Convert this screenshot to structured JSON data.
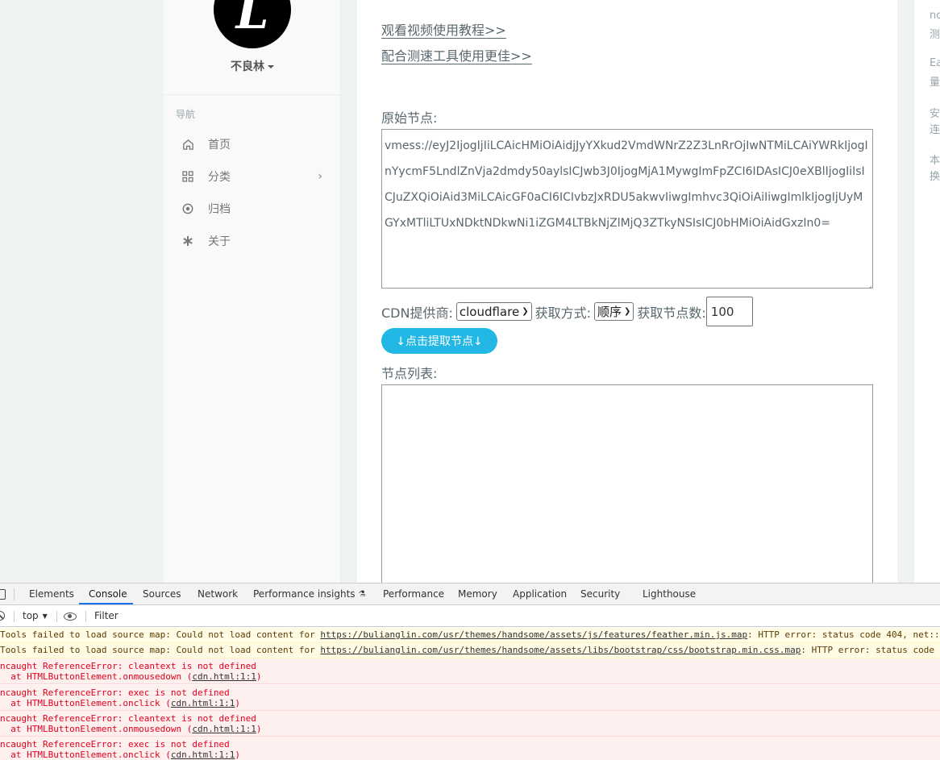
{
  "sidebar": {
    "avatar_letter": "L",
    "username": "不良林",
    "nav_heading": "导航",
    "items": [
      {
        "label": "首页",
        "icon": "home-icon"
      },
      {
        "label": "分类",
        "icon": "grid-icon"
      },
      {
        "label": "归档",
        "icon": "target-icon"
      },
      {
        "label": "关于",
        "icon": "asterisk-icon"
      }
    ]
  },
  "main": {
    "links": [
      "观看视频使用教程>>",
      "配合测速工具使用更佳>>"
    ],
    "source_label": "原始节点:",
    "source_value": "vmess://eyJ2IjogIjIiLCAicHMiOiAidjJyYXkud2VmdWNrZ2Z3LnRrOjIwNTMiLCAiYWRkIjogInYycmF5LndlZnVja2dmdy50aylsICJwb3J0IjogMjA1MywgImFpZCI6IDAsICJ0eXBlIjogIiIsICJuZXQiOiAid3MiLCAicGF0aCI6ICIvbzJxRDU5akwvIiwgImhvc3QiOiAiIiwgImlkIjogIjUyMGYxMTliLTUxNDktNDkwNi1iZGM4LTBkNjZlMjQ3ZTkyNSIsICJ0bHMiOiAidGxzIn0=",
    "cdn_label": "CDN提供商:",
    "cdn_value": "cloudflare",
    "method_label": "获取方式:",
    "method_value": "顺序",
    "count_label": "获取节点数:",
    "count_value": "100",
    "fetch_button": "↓点击提取节点↓",
    "list_label": "节点列表:",
    "list_value": ""
  },
  "right_aside": [
    "nc",
    "测",
    "Ea",
    "量",
    "安",
    "连",
    "本",
    "换"
  ],
  "devtools": {
    "tabs": [
      "Elements",
      "Console",
      "Sources",
      "Network",
      "Performance insights",
      "Performance",
      "Memory",
      "Application",
      "Security",
      "Lighthouse"
    ],
    "active_tab": "Console",
    "context": "top",
    "filter_placeholder": "Filter",
    "messages": [
      {
        "type": "warning",
        "text": "Tools failed to load source map: Could not load content for ",
        "link": "https://bulianglin.com/usr/themes/handsome/assets/js/features/feather.min.js.map",
        "tail": ": HTTP error: status code 404, net::"
      },
      {
        "type": "warning",
        "text": "Tools failed to load source map: Could not load content for ",
        "link": "https://bulianglin.com/usr/themes/handsome/assets/libs/bootstrap/css/bootstrap.min.css.map",
        "tail": ": HTTP error: status code"
      },
      {
        "type": "error",
        "line1": "ncaught ReferenceError: cleantext is not defined",
        "line2": "  at HTMLButtonElement.onmousedown (",
        "link": "cdn.html:1:1",
        "end": ")"
      },
      {
        "type": "error",
        "line1": "ncaught ReferenceError: exec is not defined",
        "line2": "  at HTMLButtonElement.onclick (",
        "link": "cdn.html:1:1",
        "end": ")"
      },
      {
        "type": "error",
        "line1": "ncaught ReferenceError: cleantext is not defined",
        "line2": "  at HTMLButtonElement.onmousedown (",
        "link": "cdn.html:1:1",
        "end": ")"
      },
      {
        "type": "error",
        "line1": "ncaught ReferenceError: exec is not defined",
        "line2": "  at HTMLButtonElement.onclick (",
        "link": "cdn.html:1:1",
        "end": ")"
      }
    ]
  },
  "colors": {
    "accent": "#23b7e5",
    "tab_active": "#1a73e8",
    "error_text": "#e0001a"
  }
}
